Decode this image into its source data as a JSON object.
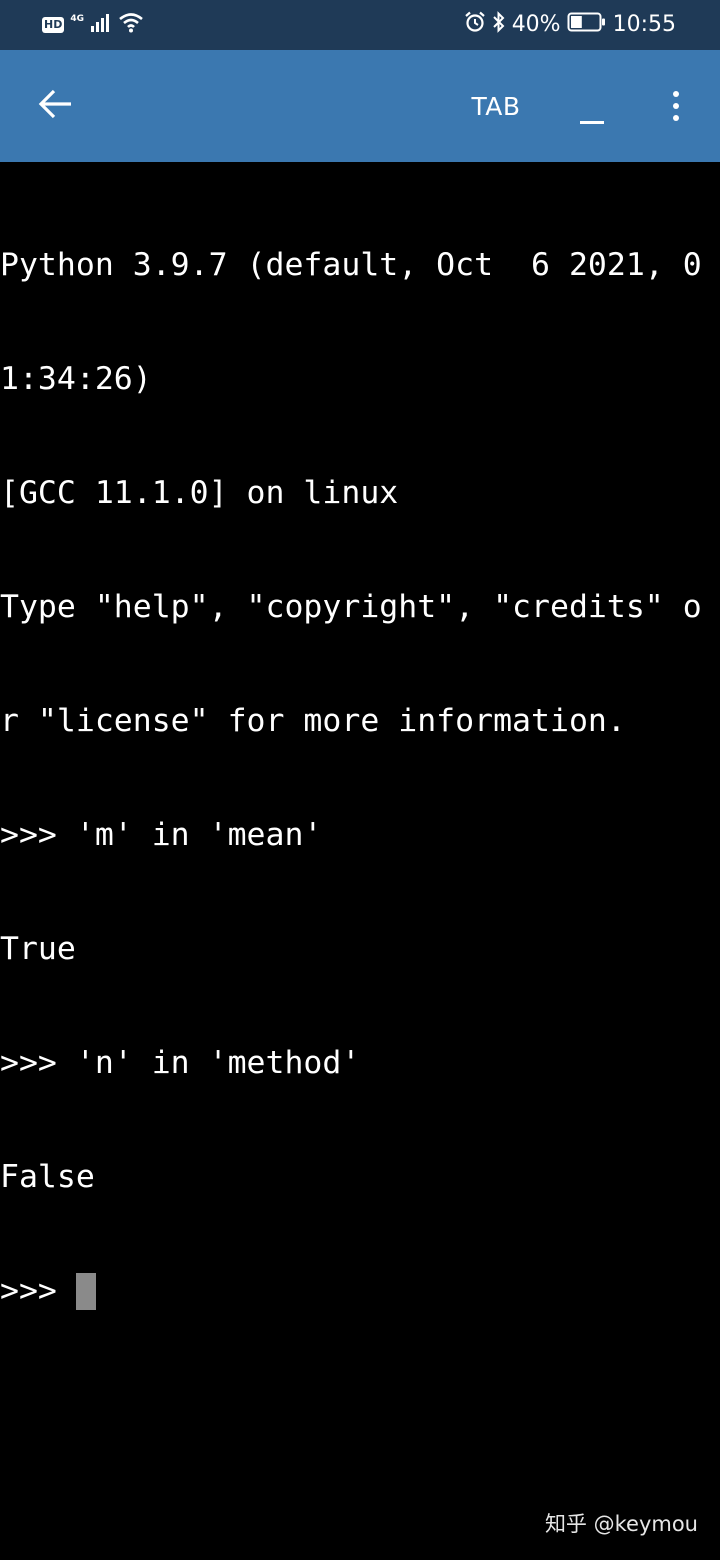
{
  "status_bar": {
    "hd_badge": "HD",
    "network_type": "4G",
    "signal_icon": "signal-bars-icon",
    "wifi_icon": "wifi-icon",
    "alarm_icon": "alarm-clock-icon",
    "bluetooth_icon": "bluetooth-icon",
    "battery_text": "40%",
    "battery_level": 0.4,
    "time": "10:55"
  },
  "app_bar": {
    "back_icon": "arrow-left-icon",
    "tab_label": "TAB",
    "underscore_icon": "underscore-key-icon",
    "menu_icon": "more-vertical-icon"
  },
  "terminal": {
    "lines": [
      "Python 3.9.7 (default, Oct  6 2021, 0",
      "1:34:26)",
      "[GCC 11.1.0] on linux",
      "Type \"help\", \"copyright\", \"credits\" o",
      "r \"license\" for more information.",
      ">>> 'm' in 'mean'",
      "True",
      ">>> 'n' in 'method'",
      "False"
    ],
    "prompt": ">>> "
  },
  "watermark": "知乎 @keymou",
  "colors": {
    "status_bar_bg": "#1f3a57",
    "app_bar_bg": "#3b78b0",
    "terminal_bg": "#000000",
    "terminal_fg": "#ffffff",
    "cursor": "#8a8a8a"
  }
}
